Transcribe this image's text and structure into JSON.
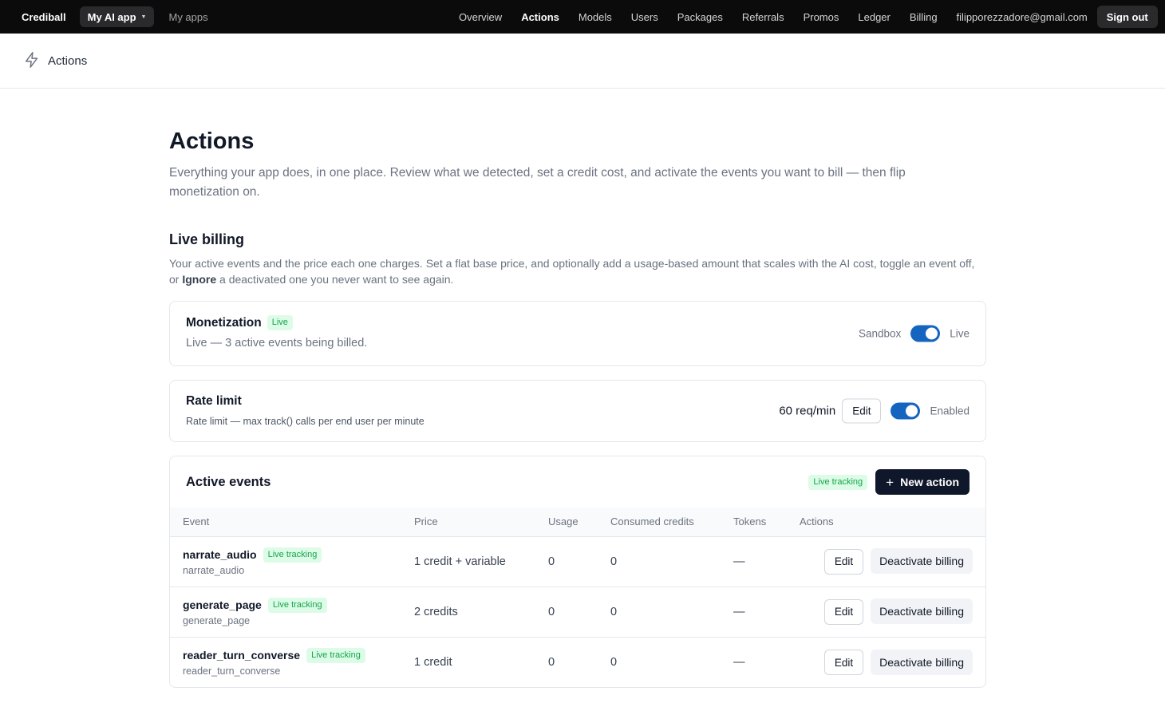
{
  "topbar": {
    "brand": "Crediball",
    "app_switcher": "My AI app",
    "my_apps": "My apps",
    "nav": [
      "Overview",
      "Actions",
      "Models",
      "Users",
      "Packages",
      "Referrals",
      "Promos",
      "Ledger",
      "Billing"
    ],
    "active_nav": "Actions",
    "email": "filipporezzadore@gmail.com",
    "sign_out": "Sign out"
  },
  "subheader": {
    "title": "Actions",
    "icon": "lightning-icon"
  },
  "page": {
    "title": "Actions",
    "lead": "Everything your app does, in one place. Review what we detected, set a credit cost, and activate the events you want to bill — then flip monetization on."
  },
  "live_billing": {
    "title": "Live billing",
    "desc_before": "Your active events and the price each one charges. Set a flat base price, and optionally add a usage-based amount that scales with the AI cost, toggle an event off, or ",
    "desc_bold": "Ignore",
    "desc_after": " a deactivated one you never want to see again."
  },
  "monetization": {
    "title": "Monetization",
    "badge": "Live",
    "subtitle": "Live — 3 active events being billed.",
    "left_label": "Sandbox",
    "right_label": "Live",
    "toggle_on": true
  },
  "rate_limit": {
    "title": "Rate limit",
    "subtitle": "Rate limit — max track() calls per end user per minute",
    "value": "60 req/min",
    "edit_label": "Edit",
    "toggle_on": true,
    "state_label": "Enabled"
  },
  "active_events": {
    "title": "Active events",
    "badge": "Live tracking",
    "new_action": "New action",
    "columns": [
      "Event",
      "Price",
      "Usage",
      "Consumed credits",
      "Tokens",
      "Actions"
    ],
    "rows": [
      {
        "name": "narrate_audio",
        "badge": "Live tracking",
        "sub": "narrate_audio",
        "price": "1 credit + variable",
        "usage": "0",
        "consumed": "0",
        "tokens": "—",
        "edit": "Edit",
        "deactivate": "Deactivate billing"
      },
      {
        "name": "generate_page",
        "badge": "Live tracking",
        "sub": "generate_page",
        "price": "2 credits",
        "usage": "0",
        "consumed": "0",
        "tokens": "—",
        "edit": "Edit",
        "deactivate": "Deactivate billing"
      },
      {
        "name": "reader_turn_converse",
        "badge": "Live tracking",
        "sub": "reader_turn_converse",
        "price": "1 credit",
        "usage": "0",
        "consumed": "0",
        "tokens": "—",
        "edit": "Edit",
        "deactivate": "Deactivate billing"
      }
    ]
  },
  "colors": {
    "accent": "#1565c0",
    "topbar": "#0b0b0c",
    "badge_bg": "#dcfce7",
    "badge_fg": "#16a34a",
    "primary_button": "#0f172a"
  }
}
